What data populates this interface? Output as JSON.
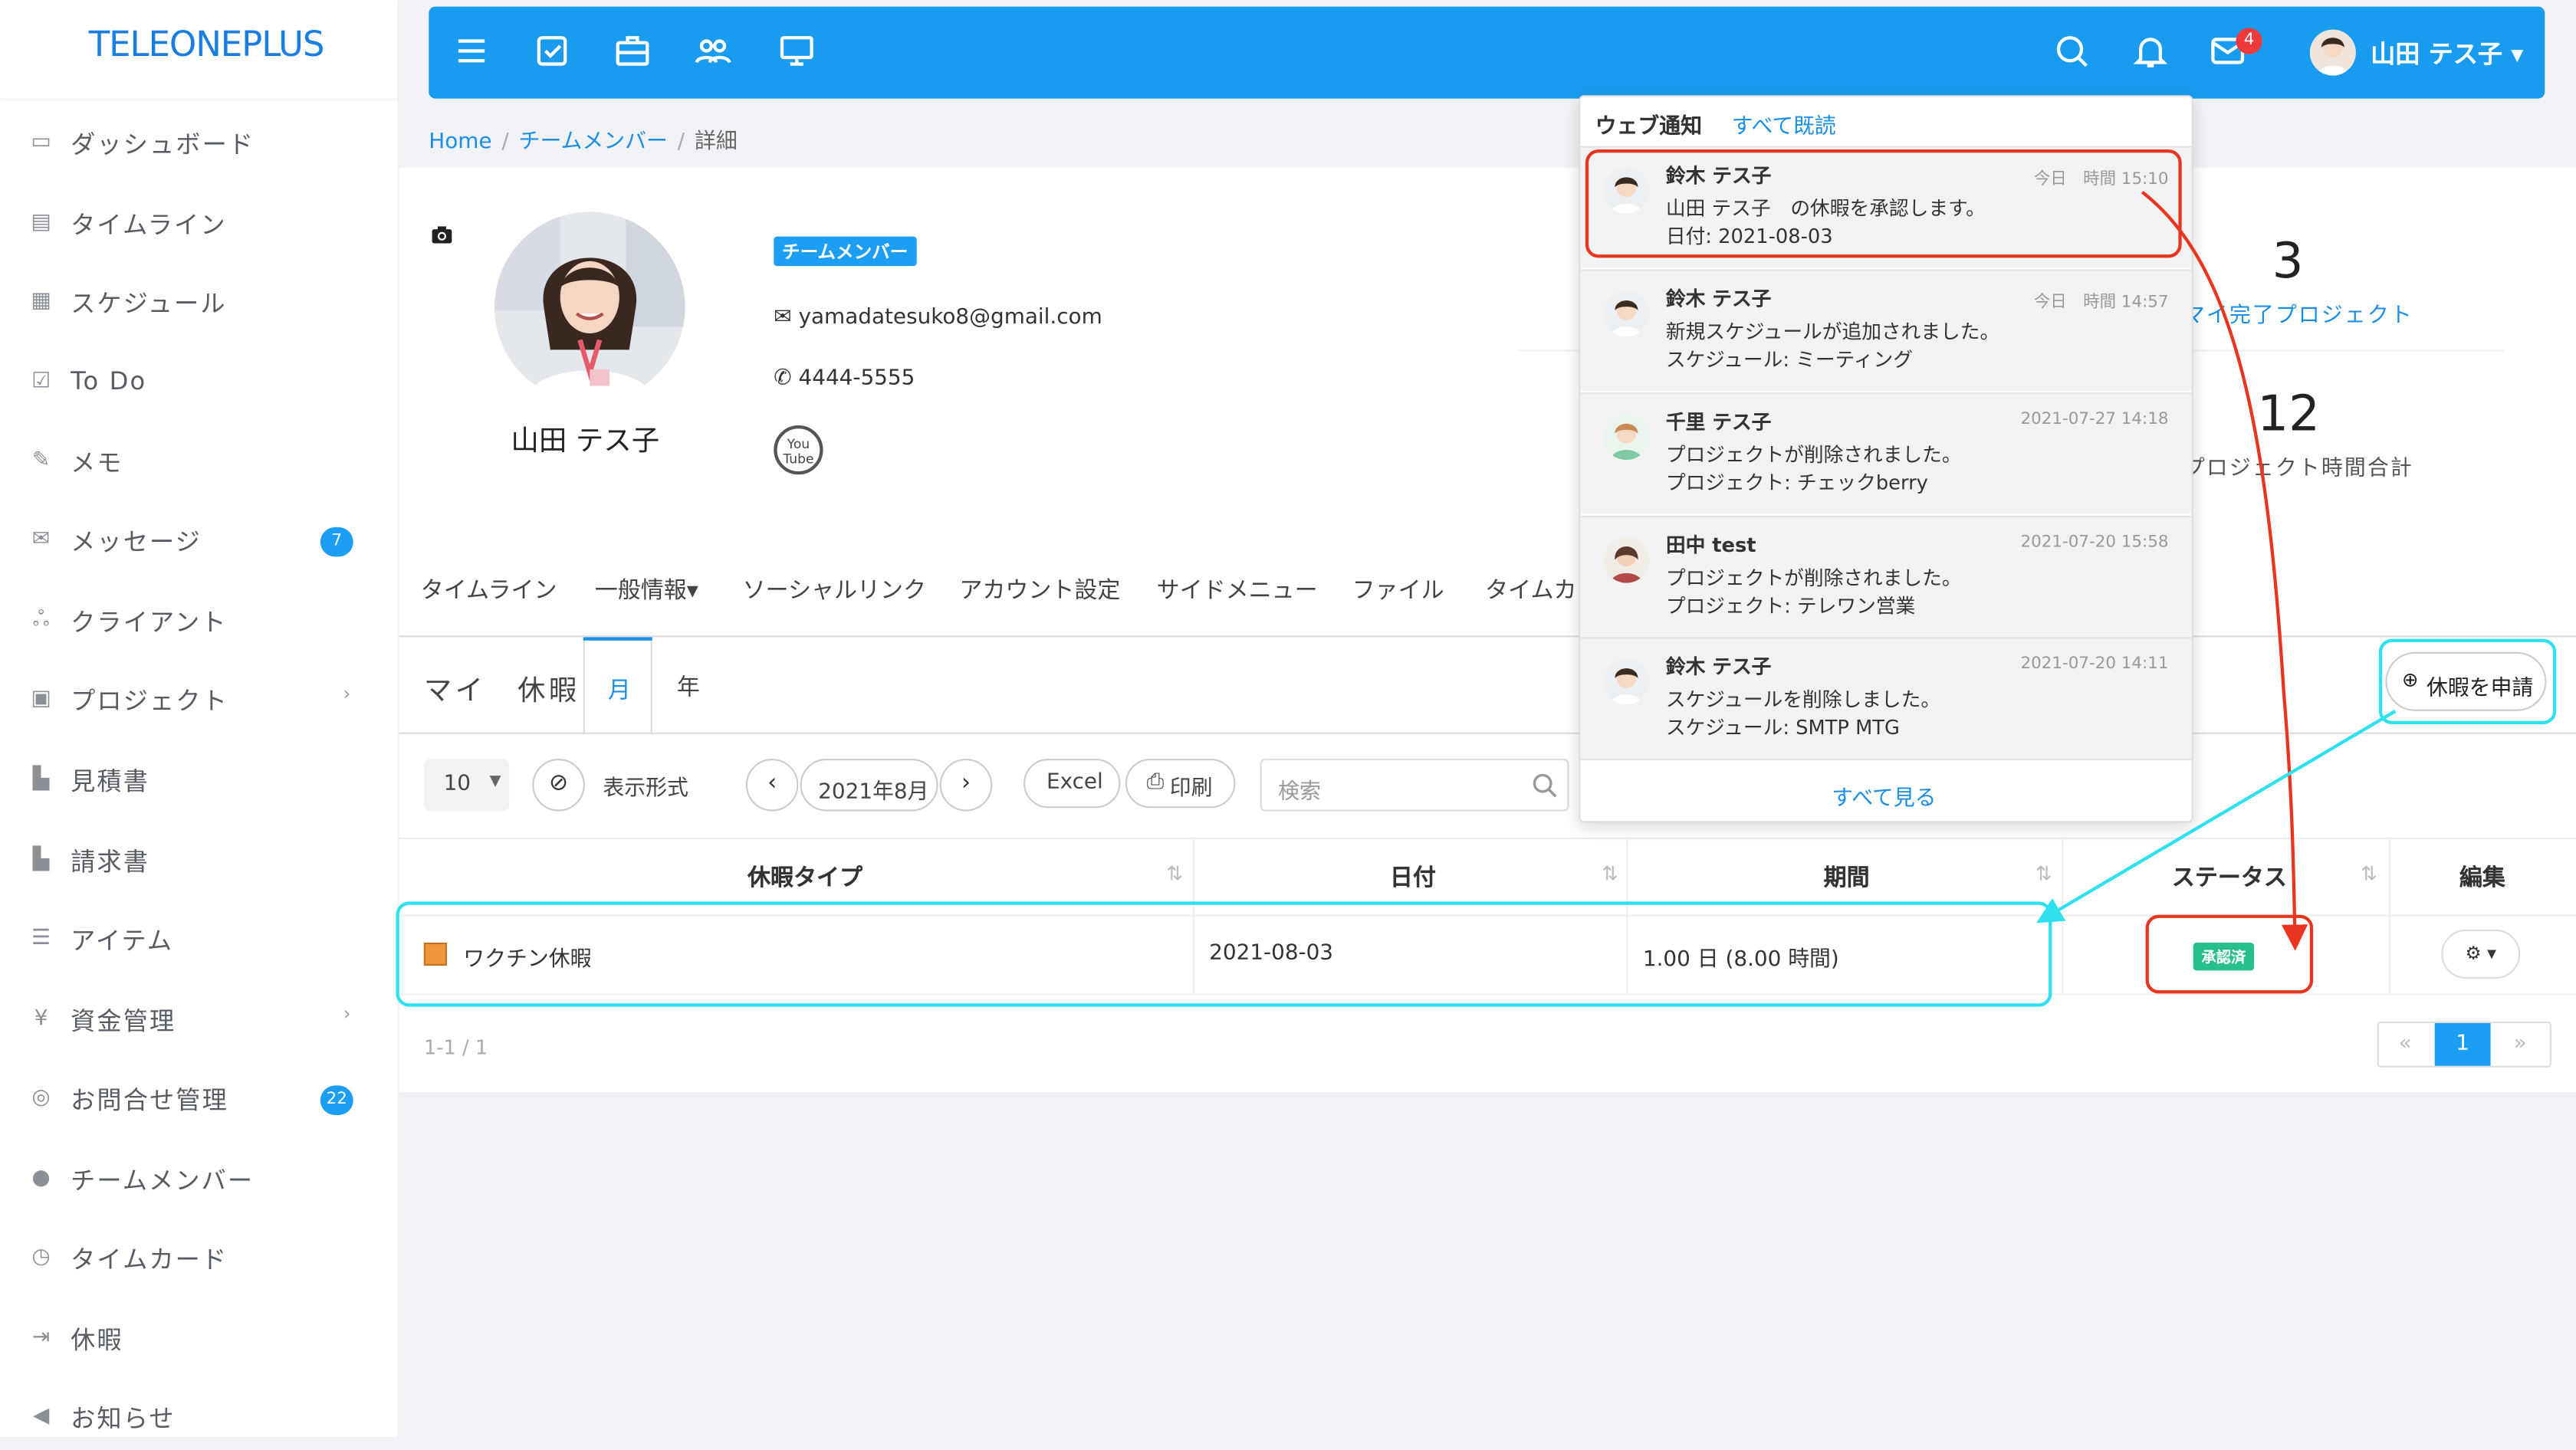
{
  "app": {
    "logo": "TELEONEPLUS"
  },
  "sidebar": {
    "items": [
      {
        "label": "ダッシュボード",
        "icon": "monitor-icon"
      },
      {
        "label": "タイムライン",
        "icon": "timeline-icon"
      },
      {
        "label": "スケジュール",
        "icon": "calendar-icon"
      },
      {
        "label": "To Do",
        "icon": "check-square-icon"
      },
      {
        "label": "メモ",
        "icon": "edit-icon"
      },
      {
        "label": "メッセージ",
        "icon": "envelope-icon",
        "badge": "7"
      },
      {
        "label": "クライアント",
        "icon": "users-icon"
      },
      {
        "label": "プロジェクト",
        "icon": "briefcase-icon",
        "chevron": "›"
      },
      {
        "label": "見積書",
        "icon": "file-icon"
      },
      {
        "label": "請求書",
        "icon": "file-icon"
      },
      {
        "label": "アイテム",
        "icon": "list-icon"
      },
      {
        "label": "資金管理",
        "icon": "yen-icon",
        "chevron": "›"
      },
      {
        "label": "お問合せ管理",
        "icon": "support-icon",
        "badge": "22"
      },
      {
        "label": "チームメンバー",
        "icon": "user-icon"
      },
      {
        "label": "タイムカード",
        "icon": "clock-icon"
      },
      {
        "label": "休暇",
        "icon": "sign-out-icon"
      },
      {
        "label": "お知らせ",
        "icon": "bullhorn-icon"
      }
    ]
  },
  "topbar": {
    "mail_badge": "4",
    "user_name": "山田 テス子 ▾"
  },
  "breadcrumb": {
    "home": "Home",
    "team": "チームメンバー",
    "current": "詳細"
  },
  "profile": {
    "name": "山田 テス子",
    "role": "チームメンバー",
    "email": "yamadatesuko8@gmail.com",
    "phone": "4444-5555",
    "youtube": "You Tube",
    "stats": [
      {
        "value": "3",
        "label": "マイ完了プロジェクト"
      },
      {
        "value": "12",
        "label": "プロジェクト時間合計"
      }
    ]
  },
  "tabs": [
    "タイムライン",
    "一般情報▾",
    "ソーシャルリンク",
    "アカウント設定",
    "サイドメニュー",
    "ファイル",
    "タイムカー"
  ],
  "leave": {
    "title": "マイ　休暇",
    "tab_month": "月",
    "tab_year": "年",
    "apply_button": "休暇を申請",
    "toolbar": {
      "page_length": "10",
      "display_format": "表示形式",
      "period": "2021年8月",
      "excel": "Excel",
      "print": "印刷",
      "search_placeholder": "検索"
    },
    "columns": [
      "休暇タイプ",
      "日付",
      "期間",
      "ステータス",
      "編集"
    ],
    "rows": [
      {
        "type": "ワクチン休暇",
        "date": "2021-08-03",
        "duration": "1.00 日 (8.00 時間)",
        "status": "承認済"
      }
    ],
    "pager_info": "1-1 / 1",
    "pager": {
      "prev": "«",
      "current": "1",
      "next": "»"
    }
  },
  "notifications": {
    "title": "ウェブ通知",
    "read_all": "すべて既読",
    "see_all": "すべて見る",
    "items": [
      {
        "from": "鈴木 テス子",
        "time": "今日　時間 15:10",
        "line1": "山田 テス子　の休暇を承認します。",
        "line2": "日付: 2021-08-03"
      },
      {
        "from": "鈴木 テス子",
        "time": "今日　時間 14:57",
        "line1": "新規スケジュールが追加されました。",
        "line2": "スケジュール: ミーティング"
      },
      {
        "from": "千里 テス子",
        "time": "2021-07-27 14:18",
        "line1": "プロジェクトが削除されました。",
        "line2": "プロジェクト: チェックberry"
      },
      {
        "from": "田中 test",
        "time": "2021-07-20 15:58",
        "line1": "プロジェクトが削除されました。",
        "line2": "プロジェクト: テレワン営業"
      },
      {
        "from": "鈴木 テス子",
        "time": "2021-07-20 14:11",
        "line1": "スケジュールを削除しました。",
        "line2": "スケジュール: SMTP MTG"
      }
    ]
  },
  "colors": {
    "primary": "#199cef",
    "annotation_red": "#e8351f",
    "annotation_cyan": "#2fe1ef",
    "approved": "#28c08a"
  }
}
